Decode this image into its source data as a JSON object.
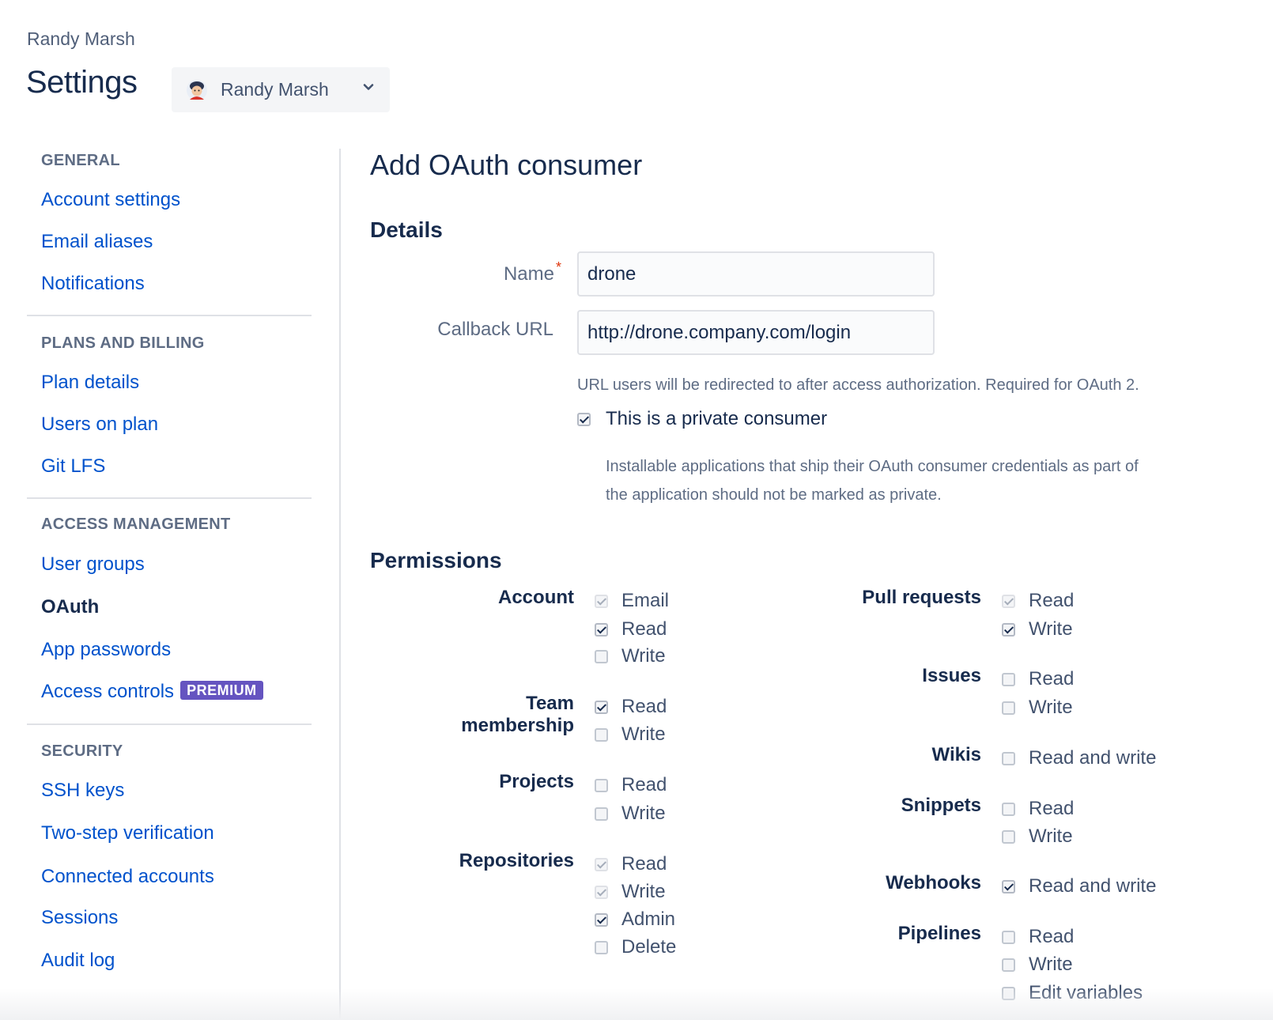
{
  "header": {
    "breadcrumb": "Randy Marsh",
    "title": "Settings",
    "account_switcher": {
      "name": "Randy Marsh",
      "icon": "chevron-down-icon"
    }
  },
  "sidebar": {
    "general": {
      "heading": "GENERAL",
      "items": [
        "Account settings",
        "Email aliases",
        "Notifications"
      ]
    },
    "plans": {
      "heading": "PLANS AND BILLING",
      "items": [
        "Plan details",
        "Users on plan",
        "Git LFS"
      ]
    },
    "access": {
      "heading": "ACCESS MANAGEMENT",
      "items": [
        "User groups",
        "OAuth",
        "App passwords",
        "Access controls"
      ],
      "active": "OAuth",
      "premium_badge": "PREMIUM"
    },
    "security": {
      "heading": "SECURITY",
      "items": [
        "SSH keys",
        "Two-step verification",
        "Connected accounts",
        "Sessions",
        "Audit log"
      ]
    }
  },
  "main": {
    "title": "Add OAuth consumer",
    "details": {
      "heading": "Details",
      "name_label": "Name",
      "required_mark": "*",
      "name_value": "drone",
      "callback_label": "Callback URL",
      "callback_value": "http://drone.company.com/login",
      "callback_help": "URL users will be redirected to after access authorization. Required for OAuth 2.",
      "private_label": "This is a private consumer",
      "private_checked": true,
      "private_help_line1": "Installable applications that ship their OAuth consumer credentials as part of",
      "private_help_line2": "the application should not be marked as private."
    },
    "permissions": {
      "heading": "Permissions",
      "account": {
        "label": "Account",
        "options": [
          "Email",
          "Read",
          "Write"
        ]
      },
      "team": {
        "label_line1": "Team",
        "label_line2": "membership",
        "options": [
          "Read",
          "Write"
        ]
      },
      "projects": {
        "label": "Projects",
        "options": [
          "Read",
          "Write"
        ]
      },
      "repositories": {
        "label": "Repositories",
        "options": [
          "Read",
          "Write",
          "Admin",
          "Delete"
        ]
      },
      "pull_requests": {
        "label": "Pull requests",
        "options": [
          "Read",
          "Write"
        ]
      },
      "issues": {
        "label": "Issues",
        "options": [
          "Read",
          "Write"
        ]
      },
      "wikis": {
        "label": "Wikis",
        "options": [
          "Read and write"
        ]
      },
      "snippets": {
        "label": "Snippets",
        "options": [
          "Read",
          "Write"
        ]
      },
      "webhooks": {
        "label": "Webhooks",
        "options": [
          "Read and write"
        ]
      },
      "pipelines": {
        "label": "Pipelines",
        "options": [
          "Read",
          "Write",
          "Edit variables"
        ]
      }
    }
  },
  "colors": {
    "link": "#0052cc",
    "heading": "#172b4d",
    "muted": "#5e6c84",
    "premium": "#6554c0"
  }
}
